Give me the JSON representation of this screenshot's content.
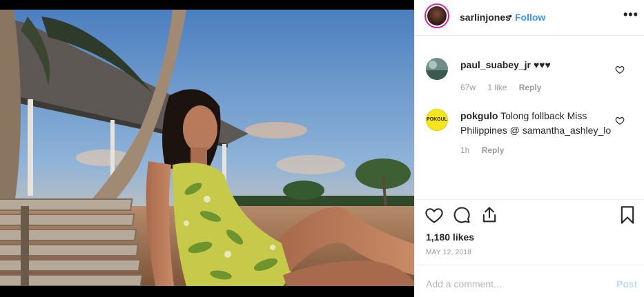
{
  "post": {
    "owner": {
      "username": "sarlinjones",
      "separator": "•",
      "follow_label": "Follow"
    },
    "more_label": "•••",
    "comments": [
      {
        "username": "paul_suabey_jr",
        "text": "♥♥♥",
        "age": "67w",
        "likes": "1 like",
        "reply_label": "Reply"
      },
      {
        "username": "pokgulo",
        "text": "Tolong follback Miss Philippines @ samantha_ashley_lo",
        "age": "1h",
        "likes": "",
        "reply_label": "Reply",
        "avatar_text": "POKGULO"
      }
    ],
    "likes_text": "1,180 likes",
    "date_text": "MAY 12, 2018",
    "comment_input": {
      "placeholder": "Add a comment...",
      "post_label": "Post"
    }
  },
  "icons": {
    "more": "more-options-icon",
    "like": "heart-icon",
    "comment": "comment-icon",
    "share": "share-icon",
    "save": "bookmark-icon"
  },
  "colors": {
    "link": "#3897f0",
    "muted": "#999999",
    "divider": "#efefef",
    "post_disabled": "#b9dcfa"
  }
}
